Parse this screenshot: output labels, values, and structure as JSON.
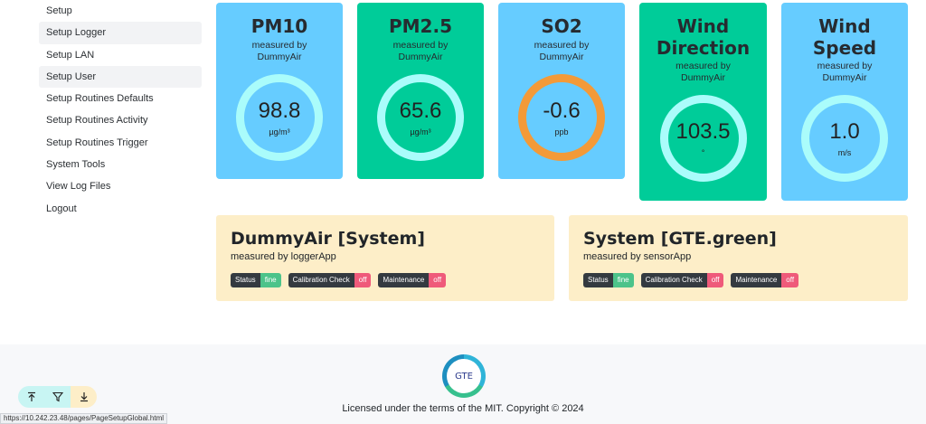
{
  "sidebar": {
    "items": [
      {
        "label": "Setup"
      },
      {
        "label": "Setup Logger"
      },
      {
        "label": "Setup LAN"
      },
      {
        "label": "Setup User"
      },
      {
        "label": "Setup Routines Defaults"
      },
      {
        "label": "Setup Routines Activity"
      },
      {
        "label": "Setup Routines Trigger"
      },
      {
        "label": "System Tools"
      },
      {
        "label": "View Log Files"
      },
      {
        "label": "Logout"
      }
    ]
  },
  "cards": [
    {
      "title": "PM10",
      "subtitle": "measured by",
      "source": "DummyAir",
      "value": "98.8",
      "unit": "µg/m³",
      "bg": "#66ccff"
    },
    {
      "title": "PM2.5",
      "subtitle": "measured by",
      "source": "DummyAir",
      "value": "65.6",
      "unit": "µg/m³",
      "bg": "#00cc99"
    },
    {
      "title": "SO2",
      "subtitle": "measured by",
      "source": "DummyAir",
      "value": "-0.6",
      "unit": "ppb",
      "bg": "#66ccff",
      "ring": "#f39a38"
    },
    {
      "title_line1": "Wind",
      "title_line2": "Direction",
      "subtitle": "measured by",
      "source": "DummyAir",
      "value": "103.5",
      "unit": "°",
      "bg": "#00cc99"
    },
    {
      "title_line1": "Wind",
      "title_line2": "Speed",
      "subtitle": "measured by",
      "source": "DummyAir",
      "value": "1.0",
      "unit": "m/s",
      "bg": "#66ccff"
    }
  ],
  "panels": [
    {
      "title": "DummyAir [System]",
      "subtitle": "measured by loggerApp",
      "badges": [
        {
          "key": "Status",
          "value": "fine"
        },
        {
          "key": "Calibration Check",
          "value": "off"
        },
        {
          "key": "Maintenance",
          "value": "off"
        }
      ]
    },
    {
      "title": "System [GTE.green]",
      "subtitle": "measured by sensorApp",
      "badges": [
        {
          "key": "Status",
          "value": "fine"
        },
        {
          "key": "Calibration Check",
          "value": "off"
        },
        {
          "key": "Maintenance",
          "value": "off"
        }
      ]
    }
  ],
  "footer": {
    "logo_text": "GTE",
    "license": "Licensed under the terms of the MIT. Copyright © 2024"
  },
  "status_url": "https://10.242.23.48/pages/PageSetupGlobal.html",
  "tools": [
    {
      "icon": "scroll-to-top-icon",
      "glyph": "⤒",
      "bg": "#c8f5f3"
    },
    {
      "icon": "filter-icon",
      "glyph": "▽",
      "bg": "#c8f5f3"
    },
    {
      "icon": "download-icon",
      "glyph": "⤓",
      "bg": "#fdeec8"
    }
  ]
}
